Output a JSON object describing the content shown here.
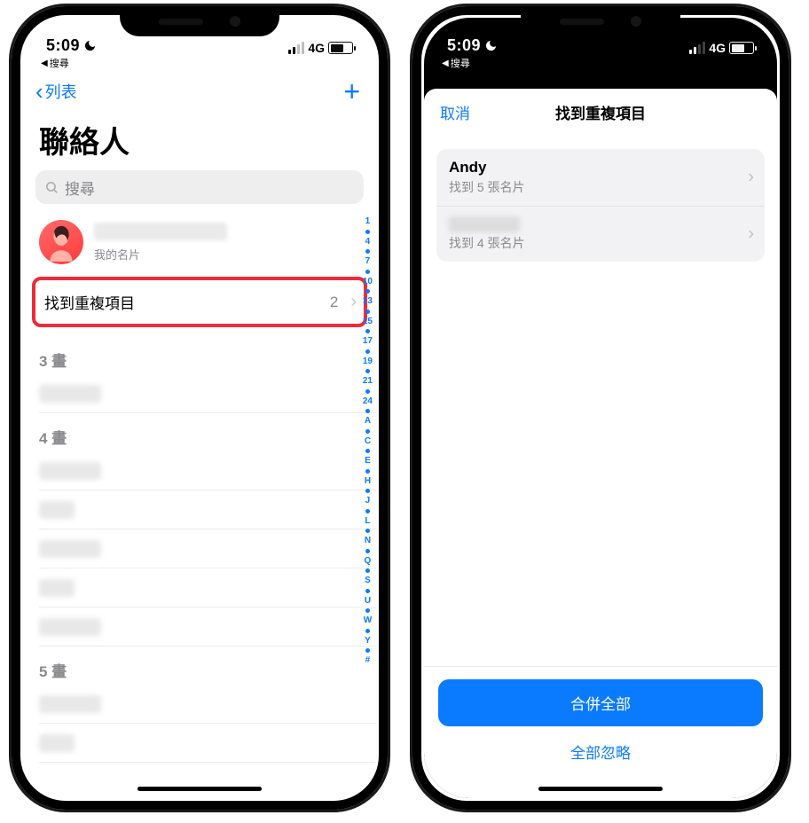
{
  "status": {
    "time": "5:09",
    "network": "4G",
    "back_breadcrumb": "搜尋"
  },
  "left": {
    "nav": {
      "back_label": "列表",
      "title": "聯絡人"
    },
    "search": {
      "placeholder": "搜尋"
    },
    "me": {
      "sub_label": "我的名片"
    },
    "duplicates": {
      "label": "找到重複項目",
      "count": "2"
    },
    "sections": [
      {
        "header": "3 畫",
        "rows": 1
      },
      {
        "header": "4 畫",
        "rows": 5
      },
      {
        "header": "5 畫",
        "rows": 2
      }
    ],
    "index": [
      "1",
      "4",
      "7",
      "10",
      "13",
      "15",
      "17",
      "19",
      "21",
      "24",
      "A",
      "C",
      "E",
      "H",
      "J",
      "L",
      "N",
      "Q",
      "S",
      "U",
      "W",
      "Y",
      "#"
    ]
  },
  "right": {
    "sheet": {
      "cancel": "取消",
      "title": "找到重複項目",
      "items": [
        {
          "name": "Andy",
          "sub": "找到 5 張名片"
        },
        {
          "name": "",
          "sub": "找到 4 張名片",
          "redacted": true
        }
      ],
      "merge_all": "合併全部",
      "ignore_all": "全部忽略"
    }
  }
}
